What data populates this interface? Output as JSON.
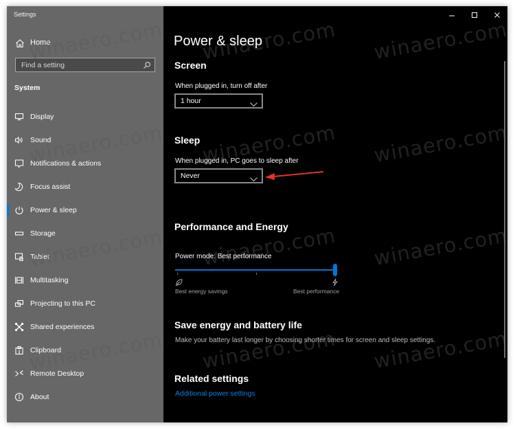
{
  "window": {
    "title": "Settings",
    "controls": {
      "minimize": "minimize-icon",
      "maximize": "maximize-icon",
      "close": "close-icon"
    }
  },
  "sidebar": {
    "home_label": "Home",
    "home_icon": "home-icon",
    "search_placeholder": "Find a setting",
    "search_icon": "search-icon",
    "section_label": "System",
    "items": [
      {
        "label": "Display",
        "icon": "display-icon",
        "selected": false
      },
      {
        "label": "Sound",
        "icon": "sound-icon",
        "selected": false
      },
      {
        "label": "Notifications & actions",
        "icon": "notifications-icon",
        "selected": false
      },
      {
        "label": "Focus assist",
        "icon": "moon-icon",
        "selected": false
      },
      {
        "label": "Power & sleep",
        "icon": "power-icon",
        "selected": true
      },
      {
        "label": "Storage",
        "icon": "storage-icon",
        "selected": false
      },
      {
        "label": "Tablet",
        "icon": "tablet-icon",
        "selected": false
      },
      {
        "label": "Multitasking",
        "icon": "multitasking-icon",
        "selected": false
      },
      {
        "label": "Projecting to this PC",
        "icon": "projecting-icon",
        "selected": false
      },
      {
        "label": "Shared experiences",
        "icon": "shared-experiences-icon",
        "selected": false
      },
      {
        "label": "Clipboard",
        "icon": "clipboard-icon",
        "selected": false
      },
      {
        "label": "Remote Desktop",
        "icon": "remote-desktop-icon",
        "selected": false
      },
      {
        "label": "About",
        "icon": "info-icon",
        "selected": false
      }
    ]
  },
  "main": {
    "page_title": "Power & sleep",
    "screen": {
      "heading": "Screen",
      "label": "When plugged in, turn off after",
      "value": "1 hour"
    },
    "sleep": {
      "heading": "Sleep",
      "label": "When plugged in, PC goes to sleep after",
      "value": "Never"
    },
    "performance": {
      "heading": "Performance and Energy",
      "label": "Power mode: Best performance",
      "slider_value_fraction": 1.0,
      "slider_ticks": 3,
      "left_caption": "Best energy savings",
      "left_icon": "leaf-icon",
      "right_caption": "Best performance",
      "right_icon": "lightning-icon"
    },
    "save_energy": {
      "heading": "Save energy and battery life",
      "description": "Make your battery last longer by choosing shorter times for screen and sleep settings."
    },
    "related": {
      "heading": "Related settings",
      "link": "Additional power settings"
    }
  },
  "annotation": {
    "type": "arrow",
    "color": "#e8302a",
    "points_to": "sleep-dropdown"
  },
  "watermark": "winaero.com",
  "colors": {
    "accent": "#0078d7",
    "link": "#0a84e0",
    "sidebar_bg": "#676767",
    "main_bg": "#000000"
  }
}
